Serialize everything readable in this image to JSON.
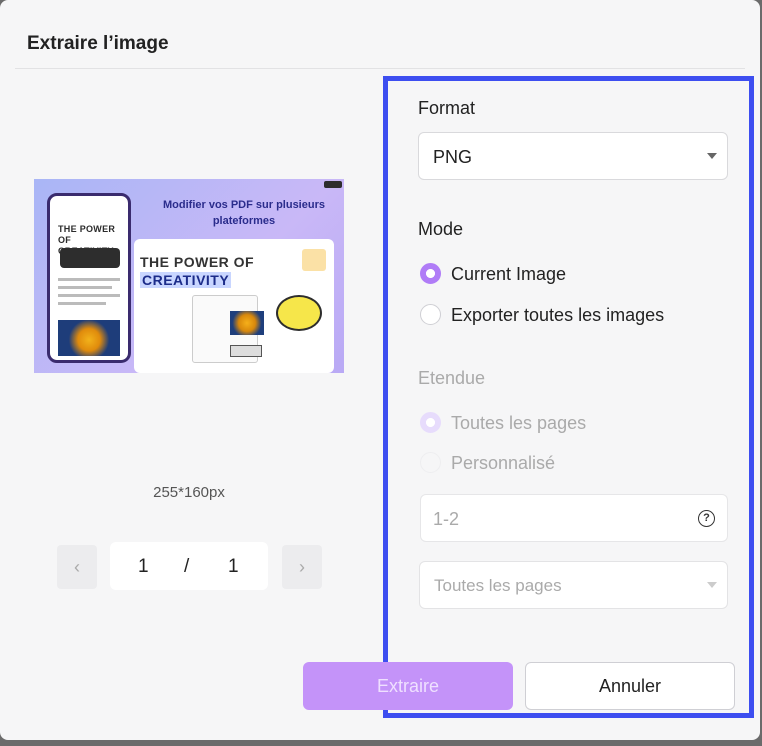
{
  "dialog": {
    "title": "Extraire l’image"
  },
  "preview": {
    "image_heading": "Modifier vos PDF sur plusieurs plateformes",
    "image_text_line1": "THE POWER OF",
    "image_text_line2": "CREATIVITY",
    "size": "255*160px"
  },
  "pager": {
    "current": "1",
    "separator": "/",
    "total": "1",
    "prev_icon": "chevron-left-icon",
    "next_icon": "chevron-right-icon"
  },
  "format": {
    "label": "Format",
    "value": "PNG"
  },
  "mode": {
    "label": "Mode",
    "options": [
      {
        "label": "Current Image",
        "checked": true
      },
      {
        "label": "Exporter toutes les images",
        "checked": false
      }
    ]
  },
  "range": {
    "label": "Etendue",
    "options": [
      {
        "label": "Toutes les pages",
        "checked": true
      },
      {
        "label": "Personnalisé",
        "checked": false
      }
    ],
    "pages_placeholder": "1-2",
    "help_icon": "question-circle-icon",
    "subset_value": "Toutes les pages"
  },
  "actions": {
    "extract": "Extraire",
    "cancel": "Annuler"
  },
  "colors": {
    "accent": "#b07cf7",
    "highlight_border": "#3d4ef0",
    "primary_button": "#c493f9"
  }
}
